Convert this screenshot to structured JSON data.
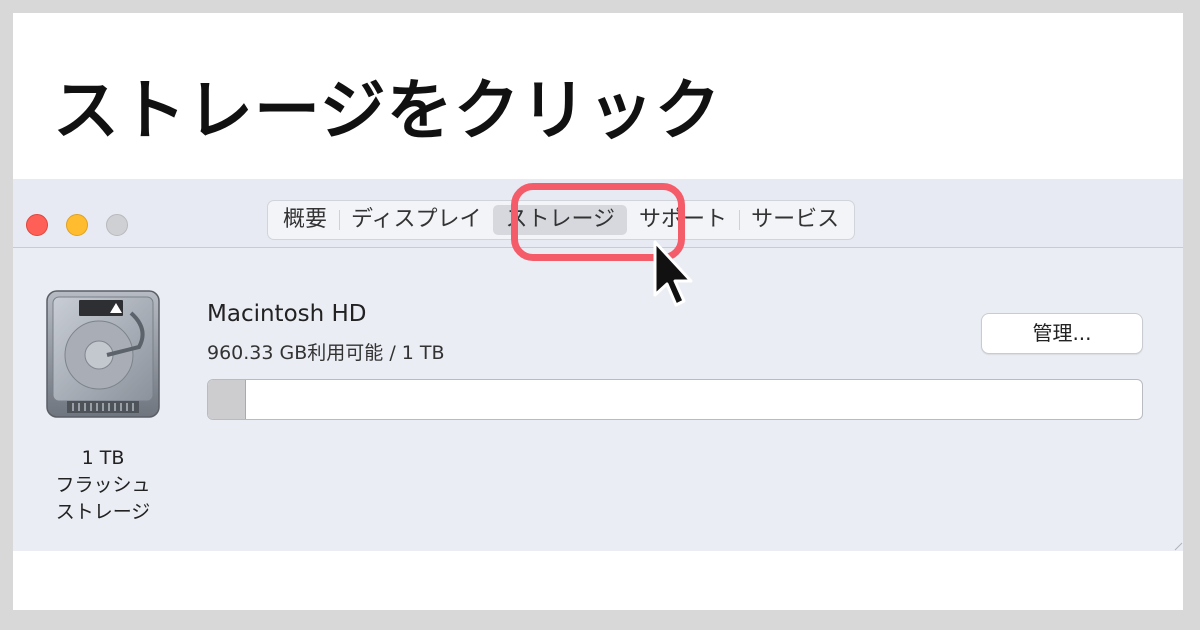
{
  "headline": "ストレージをクリック",
  "tabs": [
    {
      "label": "概要"
    },
    {
      "label": "ディスプレイ"
    },
    {
      "label": "ストレージ",
      "selected": true
    },
    {
      "label": "サポート"
    },
    {
      "label": "サービス"
    }
  ],
  "volume": {
    "name": "Macintosh HD",
    "info": "960.33 GB利用可能 / 1 TB",
    "used_fraction": 0.04
  },
  "manage_button": "管理...",
  "disk": {
    "size": "1 TB",
    "type_line1": "フラッシュ",
    "type_line2": "ストレージ"
  },
  "colors": {
    "highlight": "#f45c69",
    "close": "#fe5f57",
    "minimize": "#febc2e",
    "zoom_disabled": "#cfd0d4"
  },
  "icons": {
    "disk": "hard-drive-icon",
    "cursor": "mouse-pointer-icon"
  }
}
